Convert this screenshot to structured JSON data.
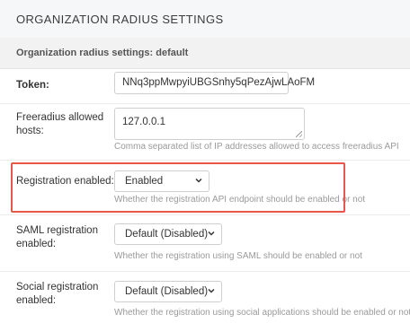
{
  "section": {
    "title": "ORGANIZATION RADIUS SETTINGS"
  },
  "subsection": {
    "title": "Organization radius settings: default"
  },
  "fields": {
    "token": {
      "label": "Token:",
      "value": "NNq3ppMwpyiUBGSnhy5qPezAjwLAoFM"
    },
    "hosts": {
      "label_line1": "Freeradius allowed",
      "label_line2": "hosts:",
      "value": "127.0.0.1",
      "help": "Comma separated list of IP addresses allowed to access freeradius API"
    },
    "registration": {
      "label": "Registration enabled:",
      "value": "Enabled",
      "help": "Whether the registration API endpoint should be enabled or not"
    },
    "saml": {
      "label_line1": "SAML registration",
      "label_line2": "enabled:",
      "value": "Default (Disabled)",
      "help": "Whether the registration using SAML should be enabled or not"
    },
    "social": {
      "label_line1": "Social registration",
      "label_line2": "enabled:",
      "value": "Default (Disabled)",
      "help": "Whether the registration using social applications should be enabled or not"
    }
  },
  "highlight_color": "#e8574a"
}
